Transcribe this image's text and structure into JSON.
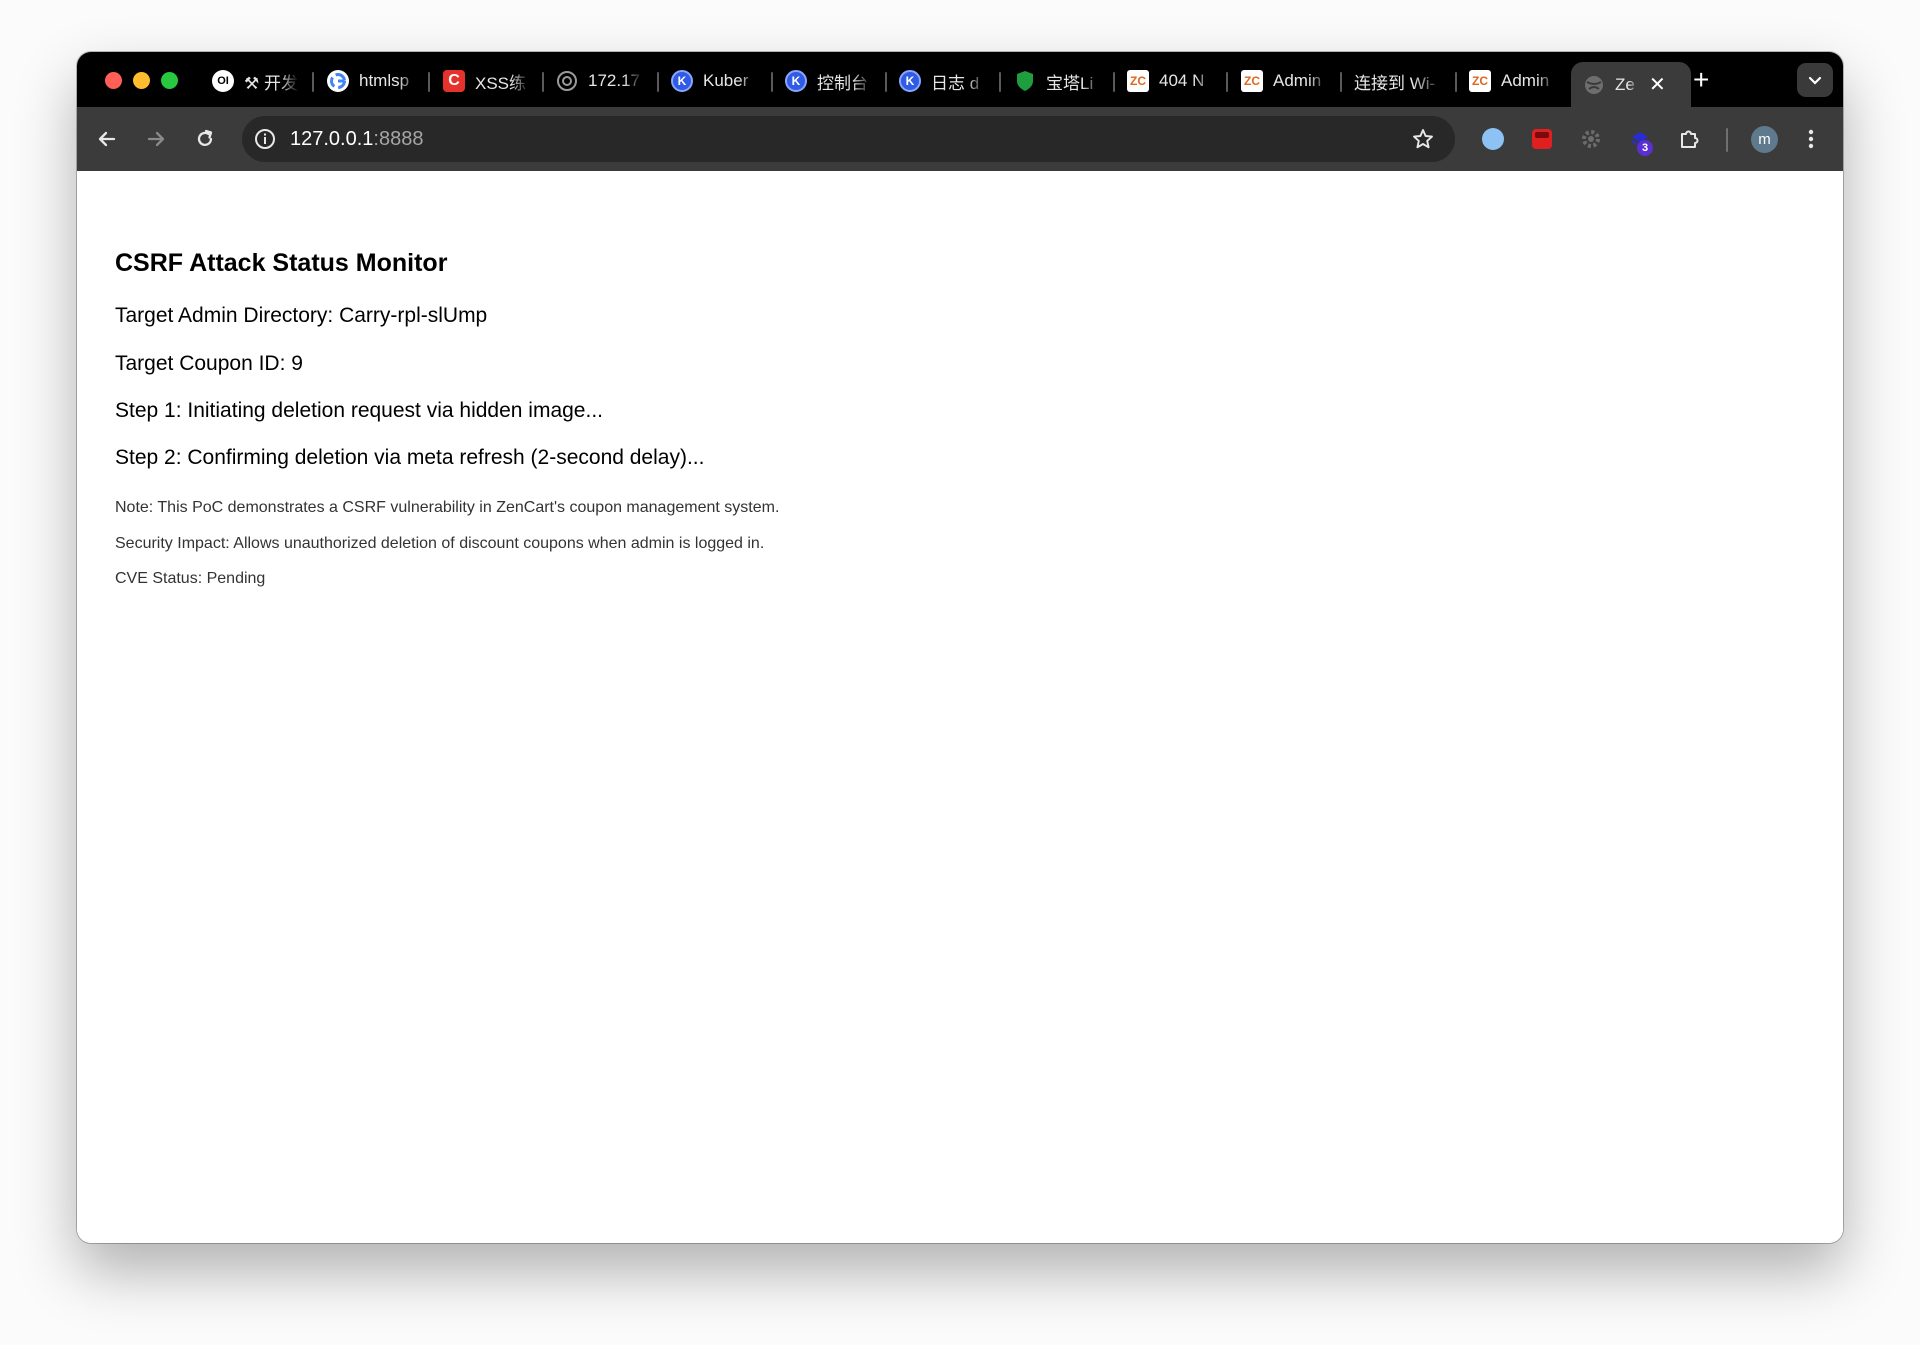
{
  "tabs": [
    {
      "title": "⚒ 开发",
      "icon": "openai-icon"
    },
    {
      "title": "htmlsp",
      "icon": "google-icon"
    },
    {
      "title": "XSS练",
      "icon": "c-icon"
    },
    {
      "title": "172.17",
      "icon": "globe-icon"
    },
    {
      "title": "Kuber",
      "icon": "k-icon"
    },
    {
      "title": "控制台",
      "icon": "k-icon"
    },
    {
      "title": "日志 d",
      "icon": "k-icon"
    },
    {
      "title": "宝塔Li",
      "icon": "shield-icon"
    },
    {
      "title": "404 N",
      "icon": "zc-icon"
    },
    {
      "title": "Admin",
      "icon": "zc-icon"
    },
    {
      "title": "连接到 Wi-",
      "icon": ""
    },
    {
      "title": "Admin",
      "icon": "zc-icon"
    }
  ],
  "active_tab": {
    "title": "Ze",
    "icon": "globe-icon"
  },
  "address": {
    "host": "127.0.0.1",
    "port": ":8888"
  },
  "profile_initial": "m",
  "extension_badge": "3",
  "page": {
    "title": "CSRF Attack Status Monitor",
    "lines": [
      "Target Admin Directory: Carry-rpl-slUmp",
      "Target Coupon ID: 9",
      "Step 1: Initiating deletion request via hidden image...",
      "Step 2: Confirming deletion via meta refresh (2-second delay)..."
    ],
    "notes": [
      "Note: This PoC demonstrates a CSRF vulnerability in ZenCart's coupon management system.",
      "Security Impact: Allows unauthorized deletion of discount coupons when admin is logged in.",
      "CVE Status: Pending"
    ]
  },
  "colors": {
    "accent_red": "#ff5f57",
    "accent_yellow": "#febc2e",
    "accent_green": "#28c840"
  }
}
